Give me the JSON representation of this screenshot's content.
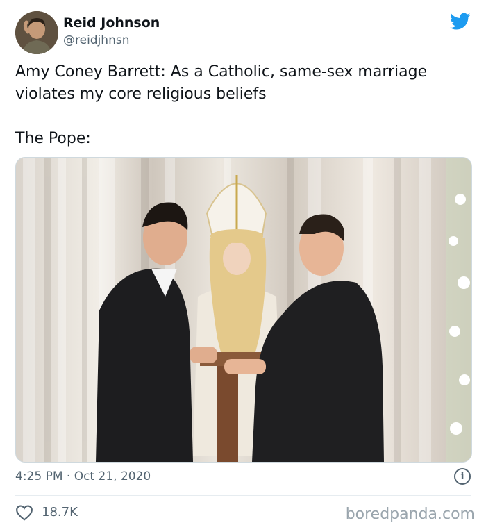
{
  "author": {
    "name": "Reid Johnson",
    "handle": "@reidjhnsn"
  },
  "tweet": {
    "line1": "Amy Coney Barrett: As a Catholic, same-sex marriage",
    "line2": "violates my core religious beliefs",
    "line3": "The Pope:"
  },
  "meta": {
    "timestamp": "4:25 PM · Oct 21, 2020",
    "likes": "18.7K",
    "info_glyph": "i"
  },
  "watermark": "boredpanda.com",
  "colors": {
    "twitter_blue": "#1d9bf0",
    "secondary_text": "#536471",
    "divider": "#e6ecf0"
  },
  "icons": {
    "brand": "twitter-bird-icon",
    "like": "heart-icon",
    "info": "info-icon"
  }
}
